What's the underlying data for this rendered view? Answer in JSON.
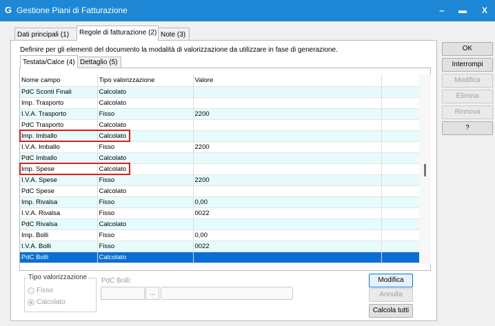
{
  "window": {
    "title": "Gestione Piani di Fatturazione",
    "icon": "app-logo-icon",
    "minimize": "‒",
    "maximize": "▬",
    "close": "X"
  },
  "tabs": [
    "Dati principali (1)",
    "Regole di fatturazione (2)",
    "Note (3)"
  ],
  "description": "Definire per gli elementi del documento la modalità di valorizzazione da utilizzare in fase di generazione.",
  "subtabs": [
    "Testata/Calce (4)",
    "Dettaglio (5)"
  ],
  "grid": {
    "columns": [
      "Nome campo",
      "Tipo valorizzazione",
      "Valore"
    ],
    "rows": [
      {
        "nome": "PdC Sconti Finali",
        "tipo": "Calcolato",
        "valore": ""
      },
      {
        "nome": "Imp. Trasporto",
        "tipo": "Calcolato",
        "valore": ""
      },
      {
        "nome": "I.V.A. Trasporto",
        "tipo": "Fisso",
        "valore": "2200"
      },
      {
        "nome": "PdC Trasporto",
        "tipo": "Calcolato",
        "valore": ""
      },
      {
        "nome": "Imp. Imballo",
        "tipo": "Calcolato",
        "valore": ""
      },
      {
        "nome": "I.V.A. Imballo",
        "tipo": "Fisso",
        "valore": "2200"
      },
      {
        "nome": "PdC Imballo",
        "tipo": "Calcolato",
        "valore": ""
      },
      {
        "nome": "Imp. Spese",
        "tipo": "Calcolato",
        "valore": ""
      },
      {
        "nome": "I.V.A. Spese",
        "tipo": "Fisso",
        "valore": "2200"
      },
      {
        "nome": "PdC Spese",
        "tipo": "Calcolato",
        "valore": ""
      },
      {
        "nome": "Imp. Rivalsa",
        "tipo": "Fisso",
        "valore": "0,00"
      },
      {
        "nome": "I.V.A. Rivalsa",
        "tipo": "Fisso",
        "valore": "0022"
      },
      {
        "nome": "PdC Rivalsa",
        "tipo": "Calcolato",
        "valore": ""
      },
      {
        "nome": "Imp. Bolli",
        "tipo": "Fisso",
        "valore": "0,00"
      },
      {
        "nome": "I.V.A. Bolli",
        "tipo": "Fisso",
        "valore": "0022"
      },
      {
        "nome": "PdC Bolli",
        "tipo": "Calcolato",
        "valore": ""
      }
    ],
    "selected_row": "PdC Bolli",
    "highlighted_rows": [
      "Imp. Imballo",
      "Imp. Spese"
    ]
  },
  "tipo_valorizzazione": {
    "legend": "Tipo valorizzazione",
    "options": [
      "Fisso",
      "Calcolato"
    ],
    "selected": "Calcolato"
  },
  "pdc_label": "PdC Bolli:",
  "ellipsis": "...",
  "detail_buttons": {
    "modifica": "Modifica",
    "annulla": "Annulla",
    "calcola": "Calcola tutti"
  },
  "side_buttons": {
    "ok": "OK",
    "interrompi": "Interrompi",
    "modifica": "Modifica",
    "elimina": "Elimina",
    "rinnova": "Rinnova",
    "help": "?"
  },
  "colors": {
    "titlebar": "#1e88d6",
    "selection": "#0a6fd2",
    "alt_row": "#e6fbfb",
    "highlight_border": "#e01a1a"
  }
}
